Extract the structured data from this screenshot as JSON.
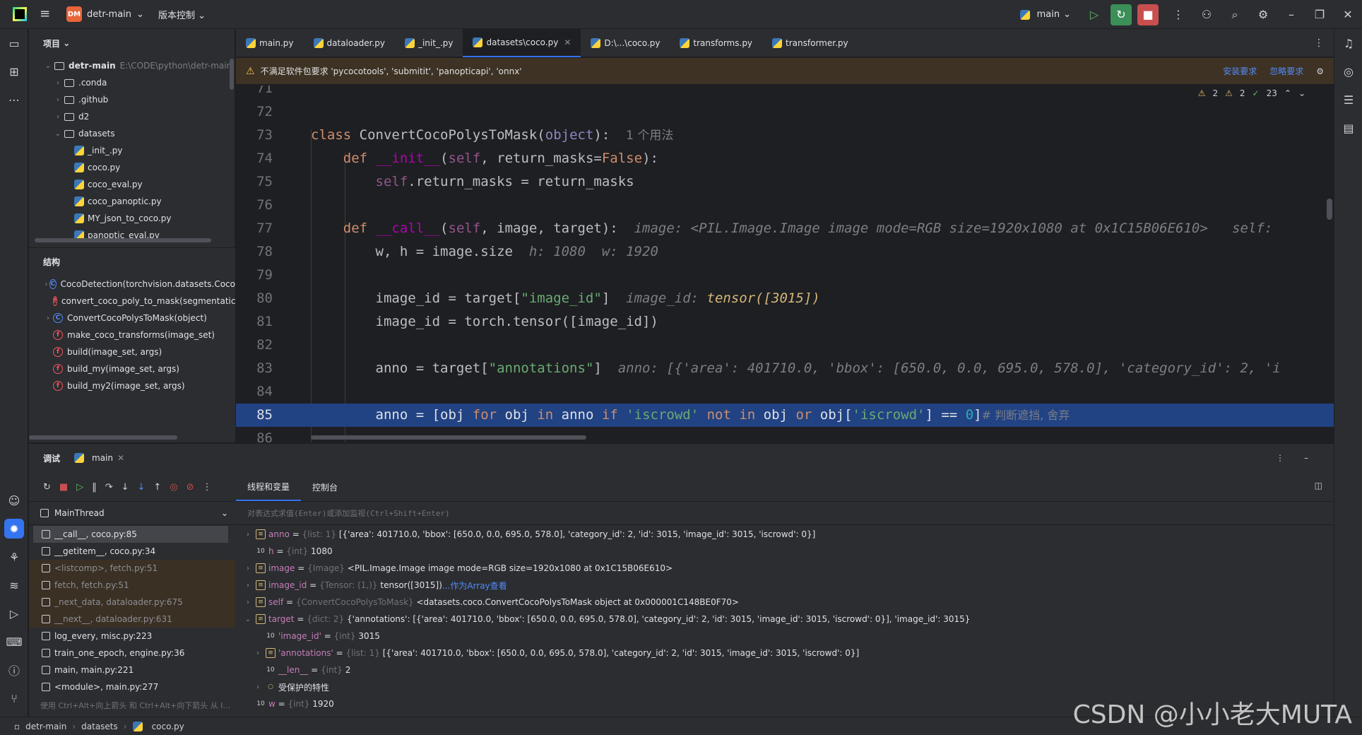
{
  "titlebar": {
    "app_badge": "DM",
    "project_name": "detr-main",
    "vcs_menu": "版本控制",
    "branch": "main"
  },
  "project": {
    "header": "项目",
    "root_name": "detr-main",
    "root_path": "E:\\CODE\\python\\detr-main",
    "items": [
      ".conda",
      ".github",
      "d2",
      "datasets"
    ],
    "files": [
      "_init_.py",
      "coco.py",
      "coco_eval.py",
      "coco_panoptic.py",
      "MY_json_to_coco.py",
      "panoptic_eval.py"
    ]
  },
  "structure": {
    "header": "结构",
    "items": [
      "CocoDetection(torchvision.datasets.Coco",
      "convert_coco_poly_to_mask(segmentatic",
      "ConvertCocoPolysToMask(object)",
      "make_coco_transforms(image_set)",
      "build(image_set, args)",
      "build_my(image_set, args)",
      "build_my2(image_set, args)"
    ]
  },
  "tabs": [
    "main.py",
    "dataloader.py",
    "_init_.py",
    "datasets\\coco.py",
    "D:\\...\\coco.py",
    "transforms.py",
    "transformer.py"
  ],
  "banner": {
    "text": "不满足软件包要求 'pycocotools', 'submitit', 'panopticapi', 'onnx'",
    "install": "安装要求",
    "ignore": "忽略要求"
  },
  "inspections": {
    "warnings": "2",
    "weak": "2",
    "ok": "23"
  },
  "editor": {
    "line_numbers": [
      "71",
      "72",
      "73",
      "74",
      "75",
      "76",
      "77",
      "78",
      "79",
      "80",
      "81",
      "82",
      "83",
      "84",
      "85",
      "86"
    ],
    "usage_hint": "1 个用法",
    "hint_image": "image: <PIL.Image.Image image mode=RGB size=1920x1080 at 0x1C15B06E610>   self:",
    "hint_h": "h: 1080",
    "hint_w": "w: 1920",
    "hint_image_id_label": "image_id:",
    "hint_image_id_val": "tensor([3015])",
    "hint_anno": "anno: [{'area': 401710.0, 'bbox': [650.0, 0.0, 695.0, 578.0], 'category_id': 2, 'i",
    "comment": "# 判断遮挡, 舍弃"
  },
  "debug": {
    "title": "调试",
    "run_tab": "main",
    "tab_threads": "线程和变量",
    "tab_console": "控制台",
    "thread": "MainThread",
    "eval_placeholder": "对表达式求值(Enter)或添加监视(Ctrl+Shift+Enter)",
    "frames": [
      "__call__, coco.py:85",
      "__getitem__, coco.py:34",
      "<listcomp>, fetch.py:51",
      "fetch, fetch.py:51",
      "_next_data, dataloader.py:675",
      "__next__, dataloader.py:631",
      "log_every, misc.py:223",
      "train_one_epoch, engine.py:36",
      "main, main.py:221",
      "<module>, main.py:277"
    ],
    "frames_hint": "使用 Ctrl+Alt+向上箭头 和 Ctrl+Alt+向下箭头 从 I...",
    "vars": [
      {
        "name": "anno",
        "type": "{list: 1}",
        "value": "[{'area': 401710.0, 'bbox': [650.0, 0.0, 695.0, 578.0], 'category_id': 2, 'id': 3015, 'image_id': 3015, 'iscrowd': 0}]"
      },
      {
        "name": "h",
        "type": "{int}",
        "value": "1080"
      },
      {
        "name": "image",
        "type": "{Image}",
        "value": "<PIL.Image.Image image mode=RGB size=1920x1080 at 0x1C15B06E610>"
      },
      {
        "name": "image_id",
        "type": "{Tensor: (1,)}",
        "value": "tensor([3015])",
        "link": "...作为Array查看"
      },
      {
        "name": "self",
        "type": "{ConvertCocoPolysToMask}",
        "value": "<datasets.coco.ConvertCocoPolysToMask object at 0x000001C148BE0F70>"
      },
      {
        "name": "target",
        "type": "{dict: 2}",
        "value": "{'annotations': [{'area': 401710.0, 'bbox': [650.0, 0.0, 695.0, 578.0], 'category_id': 2, 'id': 3015, 'image_id': 3015, 'iscrowd': 0}], 'image_id': 3015}"
      },
      {
        "name": "'image_id'",
        "type": "{int}",
        "value": "3015"
      },
      {
        "name": "'annotations'",
        "type": "{list: 1}",
        "value": "[{'area': 401710.0, 'bbox': [650.0, 0.0, 695.0, 578.0], 'category_id': 2, 'id': 3015, 'image_id': 3015, 'iscrowd': 0}]"
      },
      {
        "name": "__len__",
        "type": "{int}",
        "value": "2"
      },
      {
        "name": "受保护的特性",
        "type": "",
        "value": ""
      },
      {
        "name": "w",
        "type": "{int}",
        "value": "1920"
      }
    ]
  },
  "statusbar": {
    "crumbs": [
      "detr-main",
      "datasets",
      "coco.py"
    ]
  },
  "watermark": "CSDN @小小老大MUTA"
}
